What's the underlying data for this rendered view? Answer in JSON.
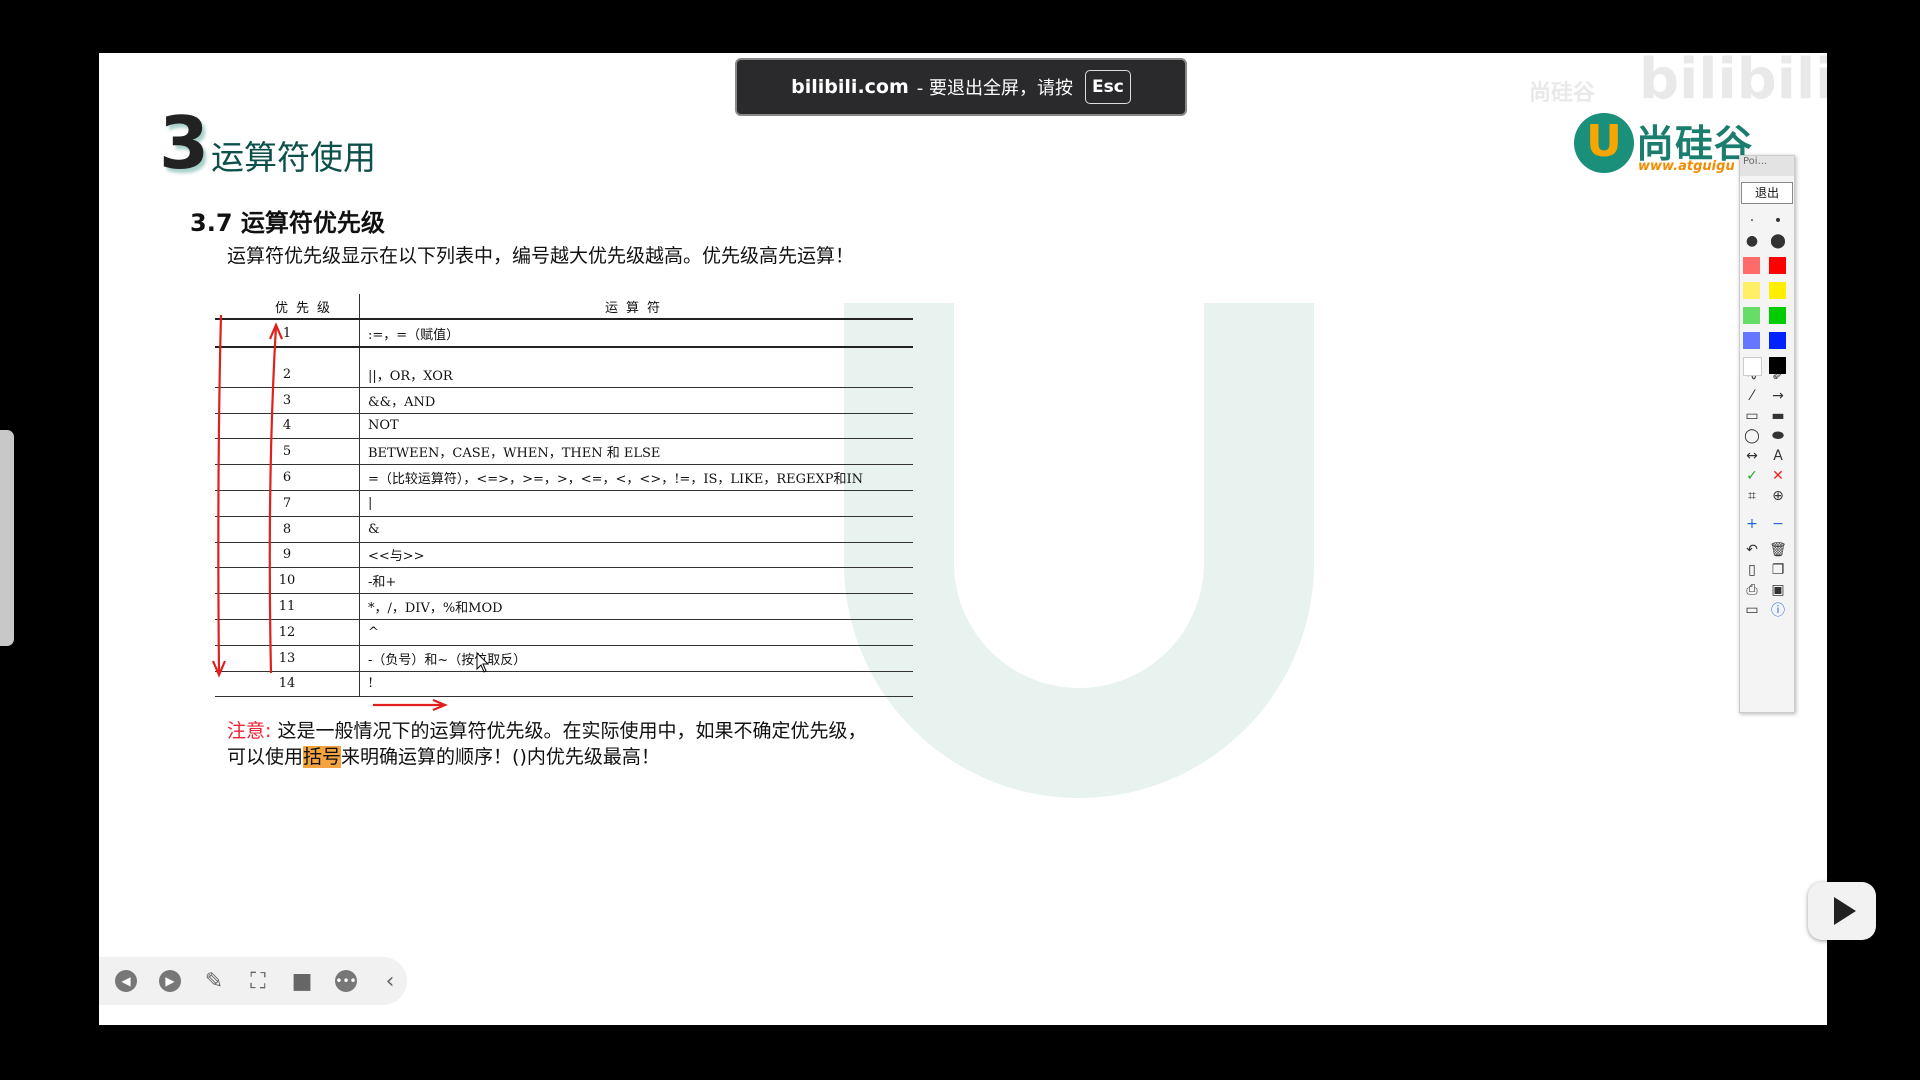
{
  "banner": {
    "site": "bilibili.com",
    "text": "- 要退出全屏，请按",
    "key": "Esc"
  },
  "slide": {
    "section_number": "3",
    "section_title": "运算符使用",
    "subtitle": "3.7 运算符优先级",
    "description": "运算符优先级显示在以下列表中，编号越大优先级越高。优先级高先运算！",
    "table": {
      "headers": [
        "优先级",
        "运算符"
      ],
      "rows": [
        {
          "n": "1",
          "op": ":=，=（赋值）"
        },
        {
          "n": "2",
          "op": "||，OR，XOR"
        },
        {
          "n": "3",
          "op": "&&，AND"
        },
        {
          "n": "4",
          "op": "NOT"
        },
        {
          "n": "5",
          "op": "BETWEEN，CASE，WHEN，THEN 和 ELSE"
        },
        {
          "n": "6",
          "op": "=（比较运算符），<=>，>=，>，<=，<，<>，!=，IS，LIKE，REGEXP和IN"
        },
        {
          "n": "7",
          "op": "|"
        },
        {
          "n": "8",
          "op": "&"
        },
        {
          "n": "9",
          "op": "<<与>>"
        },
        {
          "n": "10",
          "op": "-和+"
        },
        {
          "n": "11",
          "op": "*，/，DIV，%和MOD"
        },
        {
          "n": "12",
          "op": "^"
        },
        {
          "n": "13",
          "op": "-（负号）和~（按位取反）"
        },
        {
          "n": "14",
          "op": "!"
        }
      ]
    },
    "note": {
      "label": "注意:",
      "text1": " 这是一般情况下的运算符优先级。在实际使用中，如果不确定优先级，可以使用",
      "highlight": "括号",
      "text2": "来明确运算的顺序！()内优先级最高！"
    },
    "logo": {
      "mark": "U",
      "name": "尚硅谷",
      "url": "www.atguigu"
    },
    "watermark": {
      "cn": "尚硅谷",
      "en": "bilibili"
    }
  },
  "pen_toolbar": {
    "header": "Poi...",
    "exit_label": "退出",
    "text_tool": "A",
    "colors": [
      "#ff6b6b",
      "#ff0000",
      "#ffee66",
      "#ffee00",
      "#66dd66",
      "#00cc00",
      "#6677ff",
      "#0022ff",
      "#ffffff",
      "#000000"
    ]
  },
  "icons": [
    "prev-icon",
    "next-icon",
    "pen-icon",
    "fullscreen-icon",
    "camera-icon",
    "more-icon",
    "collapse-icon",
    "play-icon"
  ],
  "annotation_color": "#e0201c"
}
